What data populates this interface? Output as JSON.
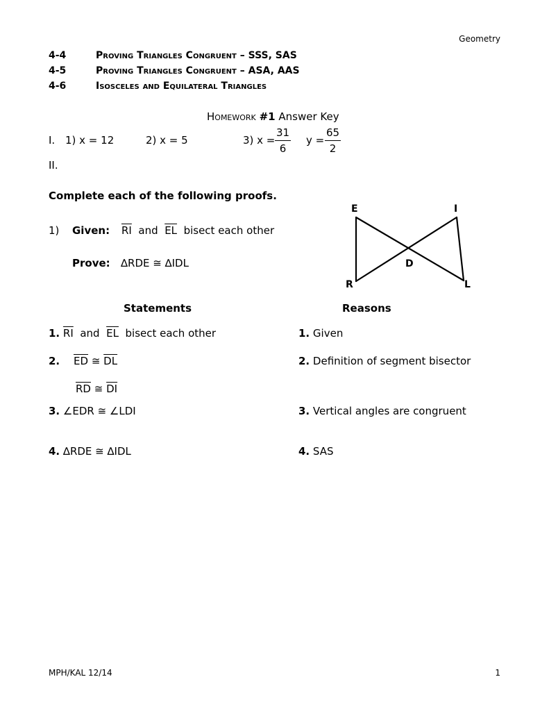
{
  "header": {
    "subject": "Geometry",
    "sections": [
      {
        "num": "4-4",
        "title": "Proving Triangles Congruent – SSS, SAS"
      },
      {
        "num": "4-5",
        "title": "Proving Triangles Congruent – ASA, AAS"
      },
      {
        "num": "4-6",
        "title": "Isosceles and Equilateral Triangles"
      }
    ]
  },
  "homework": {
    "title_sc": "Homework",
    "title_num": "#1",
    "title_rest": "Answer Key"
  },
  "part1": {
    "label": "I.",
    "a1": "1) x = 12",
    "a2": "2) x = 5",
    "a3_prefix": "3) x =",
    "a3_x_num": "31",
    "a3_x_den": "6",
    "a3_y_prefix": "y =",
    "a3_y_num": "65",
    "a3_y_den": "2"
  },
  "part2": {
    "label": "II.",
    "instruction": "Complete each of the following proofs."
  },
  "proof1": {
    "number": "1)",
    "given_label": "Given:",
    "given_seg1": "RI",
    "given_and": "and",
    "given_seg2": "EL",
    "given_rest": "bisect each other",
    "prove_label": "Prove:",
    "prove_text": "∆RDE ≅ ∆IDL",
    "diagram": {
      "labels": {
        "E": "E",
        "I": "I",
        "R": "R",
        "L": "L",
        "D": "D"
      }
    },
    "statements_header": "Statements",
    "reasons_header": "Reasons",
    "rows": [
      {
        "n": "1.",
        "reason": "Given"
      },
      {
        "n": "2.",
        "reason": "Definition of segment bisector"
      },
      {
        "n": "3.",
        "statement": "∠EDR ≅ ∠LDI",
        "reason": "Vertical angles are congruent"
      },
      {
        "n": "4.",
        "statement": "∆RDE ≅ ∆IDL",
        "reason": "SAS"
      }
    ],
    "s1": {
      "seg1": "RI",
      "and": "and",
      "seg2": "EL",
      "rest": "bisect each other"
    },
    "s2a": {
      "seg1": "ED",
      "cong": "≅",
      "seg2": "DL"
    },
    "s2b": {
      "seg1": "RD",
      "cong": "≅",
      "seg2": "DI"
    }
  },
  "footer": {
    "left": "MPH/KAL 12/14",
    "page": "1"
  }
}
